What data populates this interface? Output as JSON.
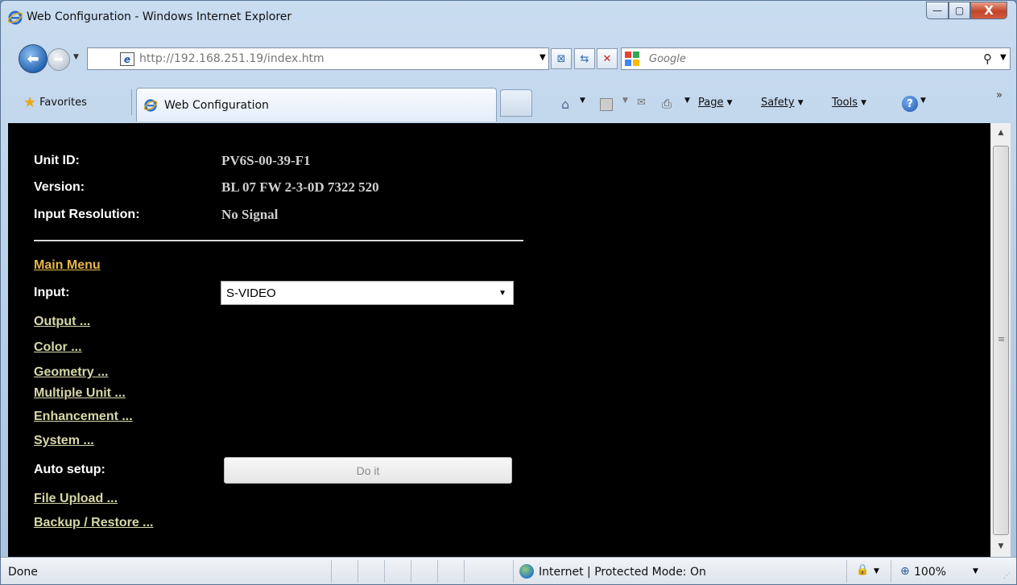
{
  "window": {
    "title": "Web Configuration - Windows Internet Explorer",
    "minimize_glyph": "—",
    "maximize_glyph": "▢",
    "close_glyph": "X"
  },
  "nav": {
    "address": "http://192.168.251.19/index.htm",
    "search_placeholder": "Google"
  },
  "tabs": {
    "favorites_label": "Favorites",
    "active_tab_label": "Web Configuration"
  },
  "toolbar": {
    "page_label": "Page",
    "safety_label": "Safety",
    "tools_label": "Tools"
  },
  "page": {
    "info": [
      {
        "label": "Unit ID:",
        "value": "PV6S-00-39-F1"
      },
      {
        "label": "Version:",
        "value": "BL 07 FW 2-3-0D 7322 520"
      },
      {
        "label": "Input Resolution:",
        "value": "No Signal"
      }
    ],
    "main_menu_link": "Main Menu",
    "input_label": "Input:",
    "input_selected": "S-VIDEO",
    "links": [
      "Output ...",
      "Color ...",
      "Geometry ...",
      "Multiple Unit ...",
      "Enhancement ...",
      "System ..."
    ],
    "auto_setup_label": "Auto setup:",
    "do_it_label": "Do it",
    "links_bottom": [
      "File Upload ...",
      "Backup / Restore ..."
    ]
  },
  "status": {
    "text": "Done",
    "zone": "Internet | Protected Mode: On",
    "zoom": "100%"
  },
  "icons": {
    "browser": "ie-logo-icon",
    "search_provider": "google-icon",
    "favorites": "star-icon",
    "home": "home-icon",
    "feeds": "feeds-icon",
    "mail": "mail-icon",
    "print": "print-icon",
    "help": "help-icon",
    "globe": "globe-icon",
    "zoom": "zoom-icon"
  },
  "colors": {
    "page_background": "#000000",
    "link": "#d8d8a8",
    "main_menu_link": "#e8b84a",
    "label": "#ffffff",
    "value": "#d0d0d0"
  }
}
